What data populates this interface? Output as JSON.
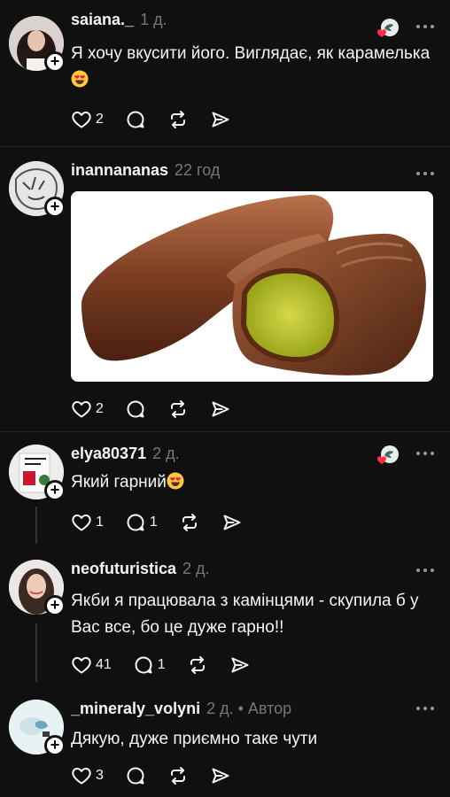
{
  "comments": [
    {
      "username": "saiana._",
      "time": "1 д.",
      "text": "Я хочу вкусити його. Виглядає, як карамелька",
      "likes": "2"
    },
    {
      "username": "inannananas",
      "time": "22 год",
      "likes": "2",
      "image_alt": "candy-photo"
    },
    {
      "username": "elya80371",
      "time": "2 д.",
      "text": "Який гарний",
      "likes": "1",
      "replies": "1"
    },
    {
      "username": "neofuturistica",
      "time": "2 д.",
      "text": "Якби я працювала з камінцями - скупила б у Вас все, бо це дуже гарно!!",
      "likes": "41",
      "replies": "1"
    },
    {
      "username": "_mineraly_volyni",
      "time": "2 д.",
      "author_tag": "• Автор",
      "text": "Дякую, дуже приємно таке чути",
      "likes": "3"
    }
  ],
  "icons": {
    "like": "heart-icon",
    "reply": "comment-icon",
    "repost": "repost-icon",
    "share": "send-icon",
    "more": "more-icon",
    "liked_by_author": "author-liked-badge"
  },
  "colors": {
    "background": "#101010",
    "text": "#f3f5f7",
    "muted": "#777777",
    "heart": "#ff3040"
  }
}
